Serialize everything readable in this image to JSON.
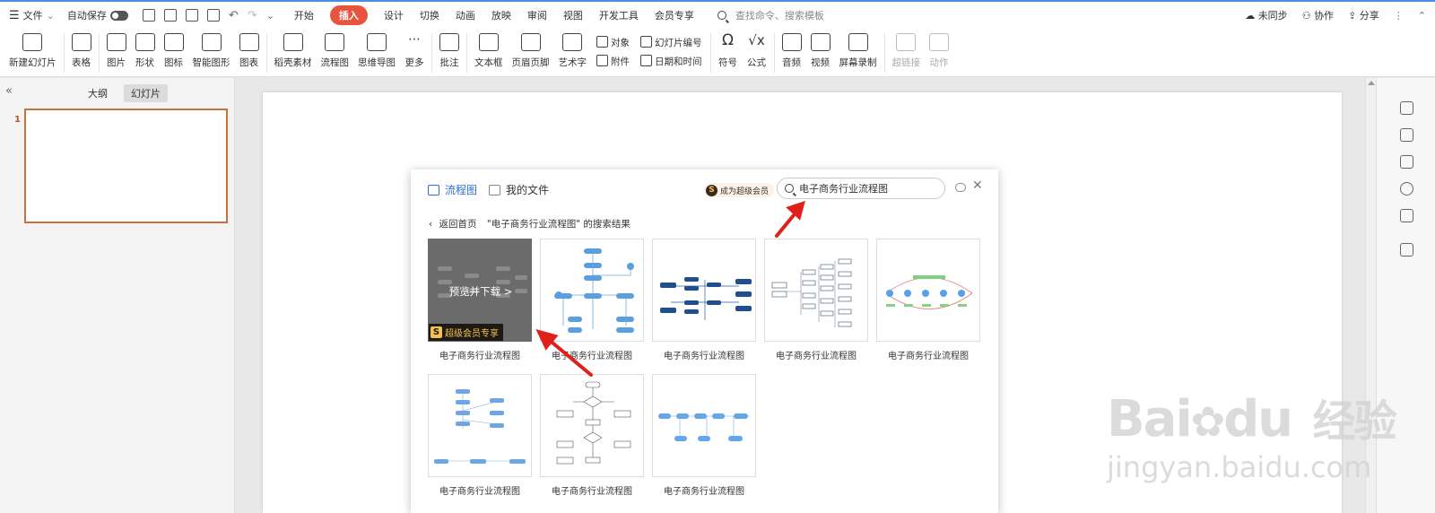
{
  "menubar": {
    "file": "文件",
    "autosave": "自动保存",
    "tabs": [
      "开始",
      "插入",
      "设计",
      "切换",
      "动画",
      "放映",
      "审阅",
      "视图",
      "开发工具",
      "会员专享"
    ],
    "search_placeholder": "查找命令、搜索模板",
    "sync": "未同步",
    "collab": "协作",
    "share": "分享"
  },
  "ribbon": {
    "new_slide": "新建幻灯片",
    "table": "表格",
    "picture": "图片",
    "shape": "形状",
    "icon": "图标",
    "smartart": "智能图形",
    "chart": "图表",
    "material": "稻壳素材",
    "flowchart": "流程图",
    "mindmap": "思维导图",
    "more": "更多",
    "comment": "批注",
    "textbox": "文本框",
    "header_footer": "页眉页脚",
    "wordart": "艺术字",
    "object": "对象",
    "attachment": "附件",
    "slide_number": "幻灯片编号",
    "datetime": "日期和时间",
    "symbol": "符号",
    "formula": "公式",
    "audio": "音频",
    "video": "视频",
    "screen_record": "屏幕录制",
    "hyperlink": "超链接",
    "action": "动作"
  },
  "left_panel": {
    "tab_outline": "大纲",
    "tab_slides": "幻灯片",
    "slide_number": "1"
  },
  "dialog": {
    "tab_flowchart": "流程图",
    "tab_my_files": "我的文件",
    "vip_badge": "成为超级会员",
    "search_value": "电子商务行业流程图",
    "back_home": "返回首页",
    "results_text": "\"电子商务行业流程图\" 的搜索结果",
    "hover_action": "预览并下载 >",
    "vip_exclusive": "超级会员专享",
    "templates": [
      {
        "title": "电子商务行业流程图"
      },
      {
        "title": "电子商务行业流程图"
      },
      {
        "title": "电子商务行业流程图"
      },
      {
        "title": "电子商务行业流程图"
      },
      {
        "title": "电子商务行业流程图"
      },
      {
        "title": "电子商务行业流程图"
      },
      {
        "title": "电子商务行业流程图"
      },
      {
        "title": "电子商务行业流程图"
      }
    ]
  },
  "watermark": {
    "brand": "Bai",
    "brand2": "du",
    "brand_cn": "经验",
    "url": "jingyan.baidu.com"
  },
  "colors": {
    "accent_tab": "#e8553e",
    "link_blue": "#2b6fd6",
    "arrow_red": "#e0211b",
    "thumb_border": "#c8713a"
  }
}
